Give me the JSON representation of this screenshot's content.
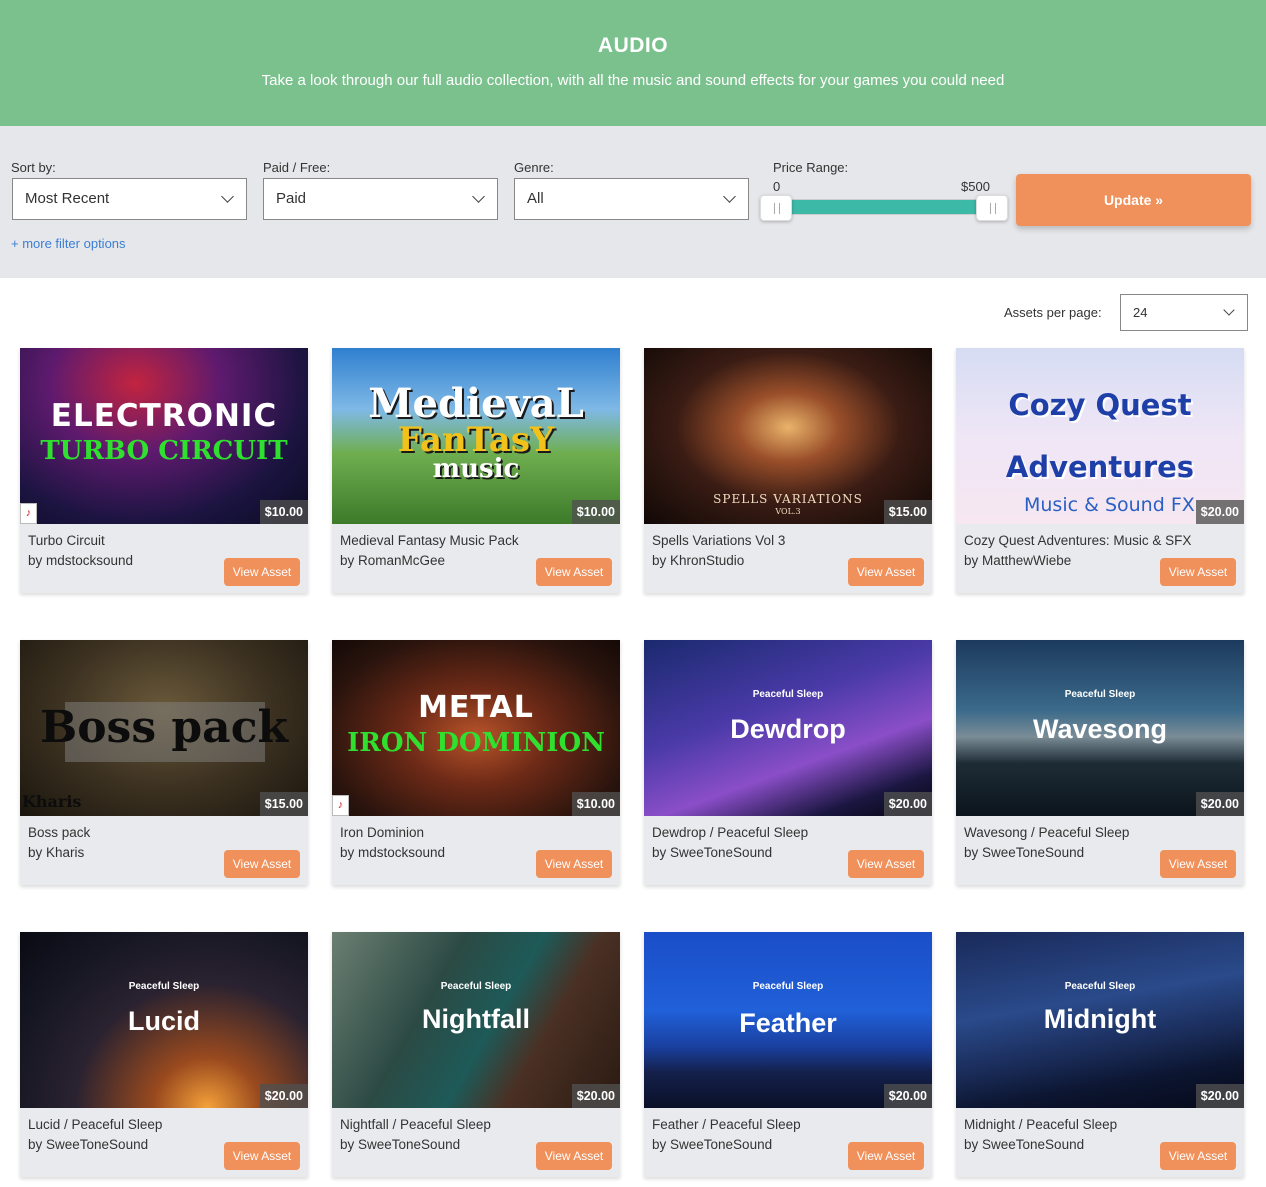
{
  "hero": {
    "title": "AUDIO",
    "subtitle": "Take a look through our full audio collection, with all the music and sound effects for your games you could need"
  },
  "filters": {
    "sort_label": "Sort by:",
    "sort_value": "Most Recent",
    "paid_label": "Paid / Free:",
    "paid_value": "Paid",
    "genre_label": "Genre:",
    "genre_value": "All",
    "price_label": "Price Range:",
    "price_min": "0",
    "price_max": "$500",
    "update_label": "Update »",
    "more_filters": "+ more filter options"
  },
  "pagination": {
    "per_page_label": "Assets per page:",
    "per_page_value": "24"
  },
  "assets": [
    {
      "title": "Turbo Circuit",
      "author": "by mdstocksound",
      "price": "$10.00",
      "button": "View Asset",
      "art_line1": "ELECTRONIC",
      "art_line2": "TURBO CIRCUIT"
    },
    {
      "title": "Medieval Fantasy Music Pack",
      "author": "by RomanMcGee",
      "price": "$10.00",
      "button": "View Asset",
      "art_line1": "MedievaL",
      "art_line2": "FanTasY",
      "art_line3": "music"
    },
    {
      "title": "Spells Variations Vol 3",
      "author": "by KhronStudio",
      "price": "$15.00",
      "button": "View Asset",
      "art_line1": "SPELLS VARIATIONS",
      "art_line2": "VOL.3"
    },
    {
      "title": "Cozy Quest Adventures: Music & SFX",
      "author": "by MatthewWiebe",
      "price": "$20.00",
      "button": "View Asset",
      "art_line1": "Cozy Quest",
      "art_line2": "Adventures",
      "art_line3": "Music & Sound FX"
    },
    {
      "title": "Boss pack",
      "author": "by Kharis",
      "price": "$15.00",
      "button": "View Asset",
      "art_line1": "Boss pack",
      "art_line2": "Kharis"
    },
    {
      "title": "Iron Dominion",
      "author": "by mdstocksound",
      "price": "$10.00",
      "button": "View Asset",
      "art_line1": "METAL",
      "art_line2": "IRON DOMINION"
    },
    {
      "title": "Dewdrop / Peaceful Sleep",
      "author": "by SweeToneSound",
      "price": "$20.00",
      "button": "View Asset",
      "art_line1": "Peaceful Sleep",
      "art_line2": "Dewdrop"
    },
    {
      "title": "Wavesong / Peaceful Sleep",
      "author": "by SweeToneSound",
      "price": "$20.00",
      "button": "View Asset",
      "art_line1": "Peaceful Sleep",
      "art_line2": "Wavesong"
    },
    {
      "title": "Lucid / Peaceful Sleep",
      "author": "by SweeToneSound",
      "price": "$20.00",
      "button": "View Asset",
      "art_line1": "Peaceful Sleep",
      "art_line2": "Lucid"
    },
    {
      "title": "Nightfall / Peaceful Sleep",
      "author": "by SweeToneSound",
      "price": "$20.00",
      "button": "View Asset",
      "art_line1": "Peaceful Sleep",
      "art_line2": "Nightfall"
    },
    {
      "title": "Feather / Peaceful Sleep",
      "author": "by SweeToneSound",
      "price": "$20.00",
      "button": "View Asset",
      "art_line1": "Peaceful Sleep",
      "art_line2": "Feather"
    },
    {
      "title": "Midnight / Peaceful Sleep",
      "author": "by SweeToneSound",
      "price": "$20.00",
      "button": "View Asset",
      "art_line1": "Peaceful Sleep",
      "art_line2": "Midnight"
    }
  ]
}
